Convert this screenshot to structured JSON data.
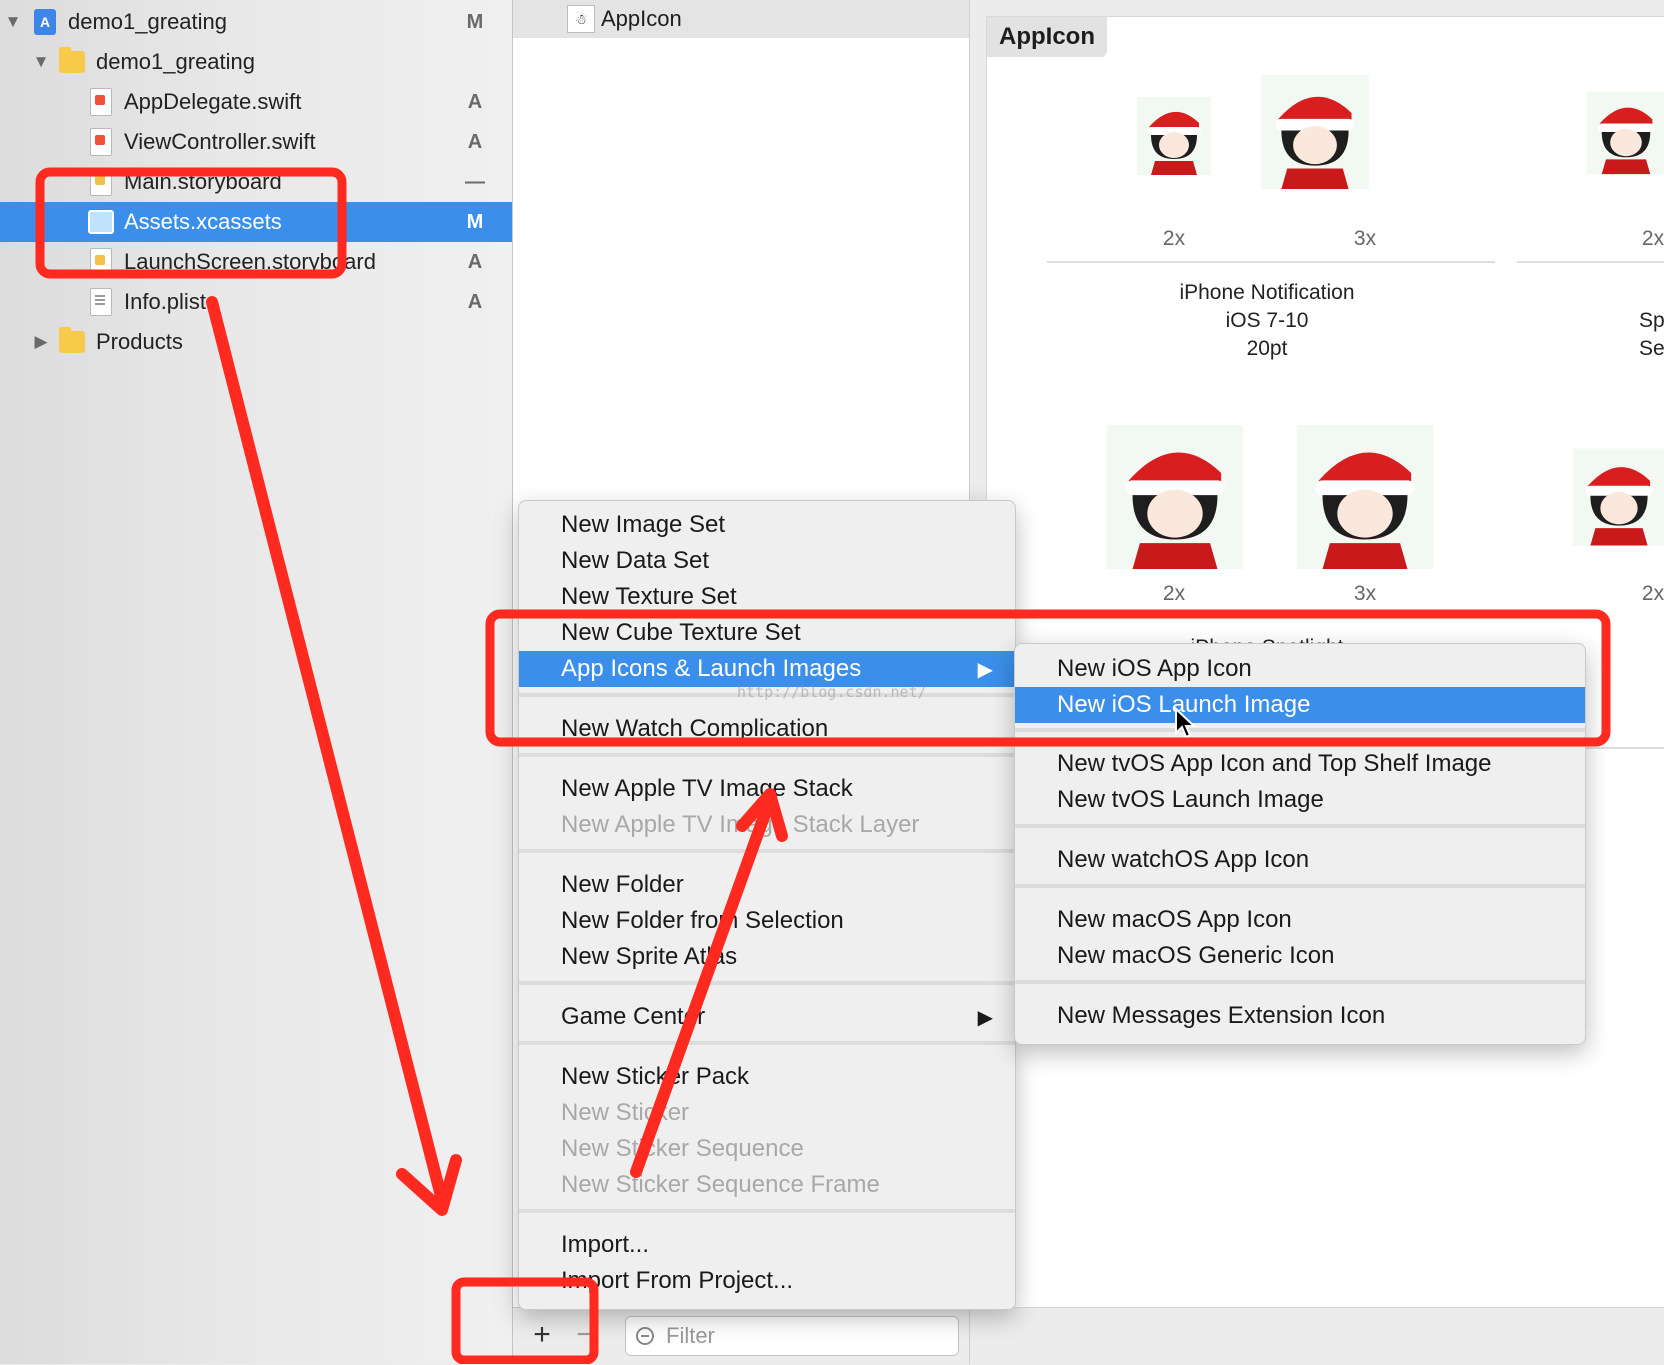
{
  "navigator": {
    "items": [
      {
        "label": "demo1_greating",
        "status": "M",
        "icon": "xcode-project-icon",
        "indent": 0,
        "disclosure": "▼"
      },
      {
        "label": "demo1_greating",
        "status": "",
        "icon": "folder-icon",
        "indent": 1,
        "disclosure": "▼"
      },
      {
        "label": "AppDelegate.swift",
        "status": "A",
        "icon": "swift-file-icon",
        "indent": 2,
        "disclosure": ""
      },
      {
        "label": "ViewController.swift",
        "status": "A",
        "icon": "swift-file-icon",
        "indent": 2,
        "disclosure": ""
      },
      {
        "label": "Main.storyboard",
        "status": "—",
        "icon": "storyboard-file-icon",
        "indent": 2,
        "disclosure": ""
      },
      {
        "label": "Assets.xcassets",
        "status": "M",
        "icon": "asset-catalog-icon",
        "indent": 2,
        "disclosure": "",
        "selected": true
      },
      {
        "label": "LaunchScreen.storyboard",
        "status": "A",
        "icon": "storyboard-file-icon",
        "indent": 2,
        "disclosure": ""
      },
      {
        "label": "Info.plist",
        "status": "A",
        "icon": "plist-file-icon",
        "indent": 2,
        "disclosure": ""
      },
      {
        "label": "Products",
        "status": "",
        "icon": "folder-icon",
        "indent": 1,
        "disclosure": "▶"
      }
    ]
  },
  "asset_list": {
    "item": {
      "label": "AppIcon",
      "icon": "app-icon-thumbnail"
    },
    "add_label": "+",
    "remove_label": "−",
    "filter_placeholder": "Filter"
  },
  "editor": {
    "title": "AppIcon",
    "row1_scales": [
      "2x",
      "3x",
      "2x"
    ],
    "row1_group_lines": [
      "iPhone Notification",
      "iOS 7-10",
      "20pt"
    ],
    "row1_side_lines": [
      "Sp",
      "Se"
    ],
    "row2_scales": [
      "2x",
      "3x",
      "2x"
    ],
    "row2_group_partial": "iPhone Spotlight"
  },
  "context_menu": {
    "items": [
      {
        "label": "New Image Set"
      },
      {
        "label": "New Data Set"
      },
      {
        "label": "New Texture Set"
      },
      {
        "label": "New Cube Texture Set"
      },
      {
        "label": "App Icons & Launch Images",
        "submenu": true,
        "highlight": true
      },
      {
        "label": "New Watch Complication"
      },
      {
        "label": "New Apple TV Image Stack"
      },
      {
        "label": "New Apple TV Image Stack Layer",
        "disabled": true
      },
      {
        "label": "New Folder"
      },
      {
        "label": "New Folder from Selection"
      },
      {
        "label": "New Sprite Atlas"
      },
      {
        "label": "Game Center",
        "submenu": true
      },
      {
        "label": "New Sticker Pack"
      },
      {
        "label": "New Sticker",
        "disabled": true
      },
      {
        "label": "New Sticker Sequence",
        "disabled": true
      },
      {
        "label": "New Sticker Sequence Frame",
        "disabled": true
      },
      {
        "label": "Import..."
      },
      {
        "label": "Import From Project..."
      }
    ],
    "submenu_arrow": "▶"
  },
  "submenu": {
    "items": [
      {
        "label": "New iOS App Icon"
      },
      {
        "label": "New iOS Launch Image",
        "highlight": true
      },
      {
        "label": "New tvOS App Icon and Top Shelf Image"
      },
      {
        "label": "New tvOS Launch Image"
      },
      {
        "label": "New watchOS App Icon"
      },
      {
        "label": "New macOS App Icon"
      },
      {
        "label": "New macOS Generic Icon"
      },
      {
        "label": "New Messages Extension Icon"
      }
    ]
  },
  "watermark": "http://blog.csdn.net/",
  "colors": {
    "selection": "#3b8fea",
    "annotation": "#ff2a1f"
  }
}
